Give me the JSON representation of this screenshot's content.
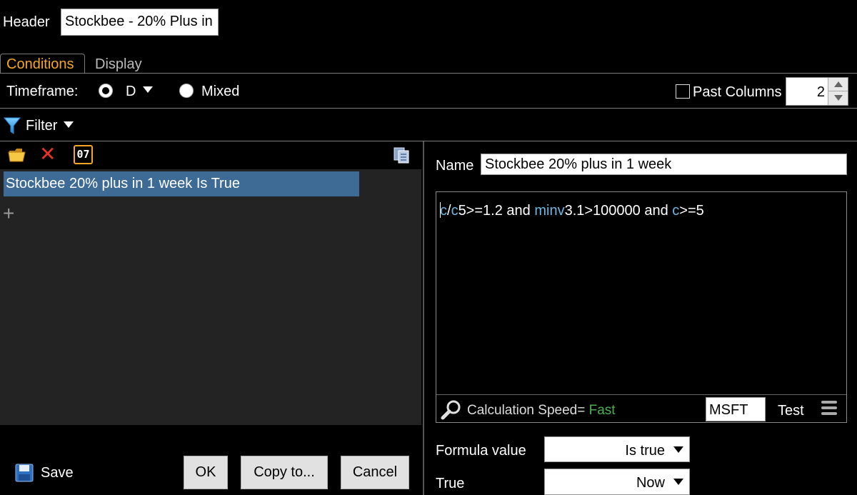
{
  "header": {
    "label": "Header",
    "value": "Stockbee - 20% Plus in"
  },
  "tabs": [
    {
      "label": "Conditions",
      "active": true
    },
    {
      "label": "Display",
      "active": false
    }
  ],
  "timeframe": {
    "label": "Timeframe:",
    "options": [
      {
        "label": "D",
        "selected": true
      },
      {
        "label": "Mixed",
        "selected": false
      }
    ],
    "past_columns_label": "Past Columns",
    "past_columns_checked": false,
    "past_columns_value": "2"
  },
  "filter": {
    "label": "Filter"
  },
  "conditions": {
    "items": [
      "Stockbee 20% plus in 1 week Is True"
    ]
  },
  "footer": {
    "save_label": "Save",
    "ok_label": "OK",
    "copy_label": "Copy to...",
    "cancel_label": "Cancel"
  },
  "editor": {
    "name_label": "Name",
    "name_value": "Stockbee 20% plus in 1 week",
    "formula_tokens": [
      {
        "text": "c",
        "kw": true
      },
      {
        "text": "/",
        "kw": false
      },
      {
        "text": "c",
        "kw": true
      },
      {
        "text": "5>=1.2 and ",
        "kw": false
      },
      {
        "text": "minv",
        "kw": true
      },
      {
        "text": "3.1>100000 and ",
        "kw": false
      },
      {
        "text": "c",
        "kw": true
      },
      {
        "text": ">=5",
        "kw": false
      }
    ],
    "speed_label": "Calculation Speed=",
    "speed_value": "Fast",
    "symbol_value": "MSFT",
    "test_label": "Test",
    "formula_value_label": "Formula value",
    "formula_value_selected": "Is true",
    "true_label": "True",
    "true_selected": "Now"
  },
  "colors": {
    "accent_tab": "#f5a623",
    "selection": "#3d6b95",
    "keyword": "#6fb6e3",
    "speed_fast": "#4caf50",
    "delete_red": "#e8322a"
  }
}
